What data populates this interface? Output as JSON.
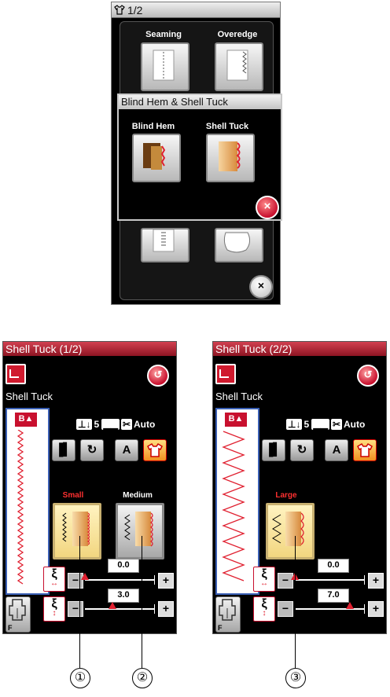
{
  "top": {
    "title": "1/2",
    "buttons": [
      {
        "label": "Seaming"
      },
      {
        "label": "Overedge"
      }
    ],
    "popup": {
      "title": "Blind Hem & Shell Tuck",
      "buttons": [
        {
          "label": "Blind Hem"
        },
        {
          "label": "Shell Tuck"
        }
      ],
      "close": "×"
    },
    "close": "×"
  },
  "screens": [
    {
      "title": "Shell Tuck  (1/2)",
      "pattern_name": "Shell Tuck",
      "presser": "5",
      "auto": "Auto",
      "back": "↺",
      "tool_letter": "A",
      "sizes": [
        {
          "label": "Small",
          "color": "#ff3030"
        },
        {
          "label": "Medium",
          "color": "#ffffff"
        }
      ],
      "width_value": "0.0",
      "length_value": "3.0",
      "width_fraction": 0.0,
      "length_fraction": 0.4,
      "foot_letter": "F"
    },
    {
      "title": "Shell Tuck  (2/2)",
      "pattern_name": "Shell Tuck",
      "presser": "5",
      "auto": "Auto",
      "back": "↺",
      "tool_letter": "A",
      "sizes": [
        {
          "label": "Large",
          "color": "#ff3030"
        }
      ],
      "width_value": "0.0",
      "length_value": "7.0",
      "width_fraction": 0.0,
      "length_fraction": 0.8,
      "foot_letter": "F"
    }
  ],
  "callouts": [
    "①",
    "②",
    "③"
  ]
}
